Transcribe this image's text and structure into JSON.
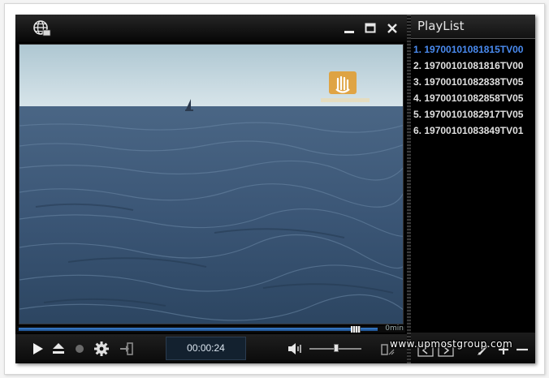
{
  "titlebar": {
    "icon": "globe-icon",
    "buttons": [
      "minimize-icon",
      "maximize-icon",
      "close-icon"
    ]
  },
  "video": {
    "overlay_logo": "hand-logo",
    "overlay_caption": ""
  },
  "seek": {
    "duration_label": "0min",
    "progress": 0.93
  },
  "controls": {
    "current_time": "00:00:24",
    "volume": 0.5,
    "icons": [
      "play-icon",
      "eject-icon",
      "record-icon",
      "gear-icon",
      "exit-icon",
      "volume-icon",
      "resize-icon"
    ]
  },
  "playlist": {
    "title": "PlayList",
    "items": [
      {
        "label": "1. 19700101081815TV00",
        "active": true
      },
      {
        "label": "2. 19700101081816TV00",
        "active": false
      },
      {
        "label": "3. 19700101082838TV05",
        "active": false
      },
      {
        "label": "4. 19700101082858TV05",
        "active": false
      },
      {
        "label": "5. 19700101082917TV05",
        "active": false
      },
      {
        "label": "6. 19700101083849TV01",
        "active": false
      }
    ],
    "footer_icons": [
      "prev-icon",
      "next-icon",
      "edit-icon",
      "add-icon",
      "remove-icon"
    ]
  },
  "watermark": "www.upmostgroup.com",
  "colors": {
    "active_item": "#4a8bf0",
    "seek_fill": "#3b7dc9",
    "sea": "#3e5a78",
    "sky": "#c9dbe3"
  }
}
